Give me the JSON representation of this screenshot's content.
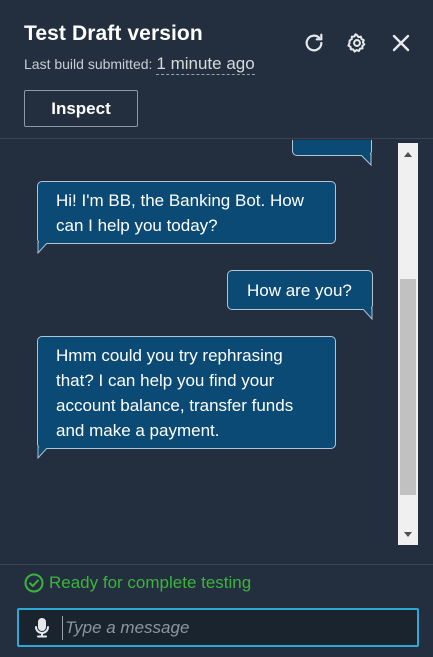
{
  "header": {
    "title": "Test Draft version",
    "subtitle_label": "Last build submitted:",
    "subtitle_time": "1 minute ago",
    "inspect_label": "Inspect",
    "icons": [
      "refresh-icon",
      "settings-icon",
      "close-icon"
    ]
  },
  "messages": [
    {
      "sender": "bot",
      "text": "Hi! I'm BB, the Banking Bot. How can I help you today?"
    },
    {
      "sender": "user",
      "text": "How are you?"
    },
    {
      "sender": "bot",
      "text": "Hmm could you try rephrasing that? I can help you find your account balance, transfer funds and make a payment."
    }
  ],
  "footer": {
    "status": "Ready for complete testing",
    "input_placeholder": "Type a message"
  },
  "colors": {
    "background": "#232f3e",
    "bubble": "#0b4a75",
    "bubble_border": "#b0c4d6",
    "status_green": "#3cb43c",
    "input_focus": "#2fa8d6"
  }
}
